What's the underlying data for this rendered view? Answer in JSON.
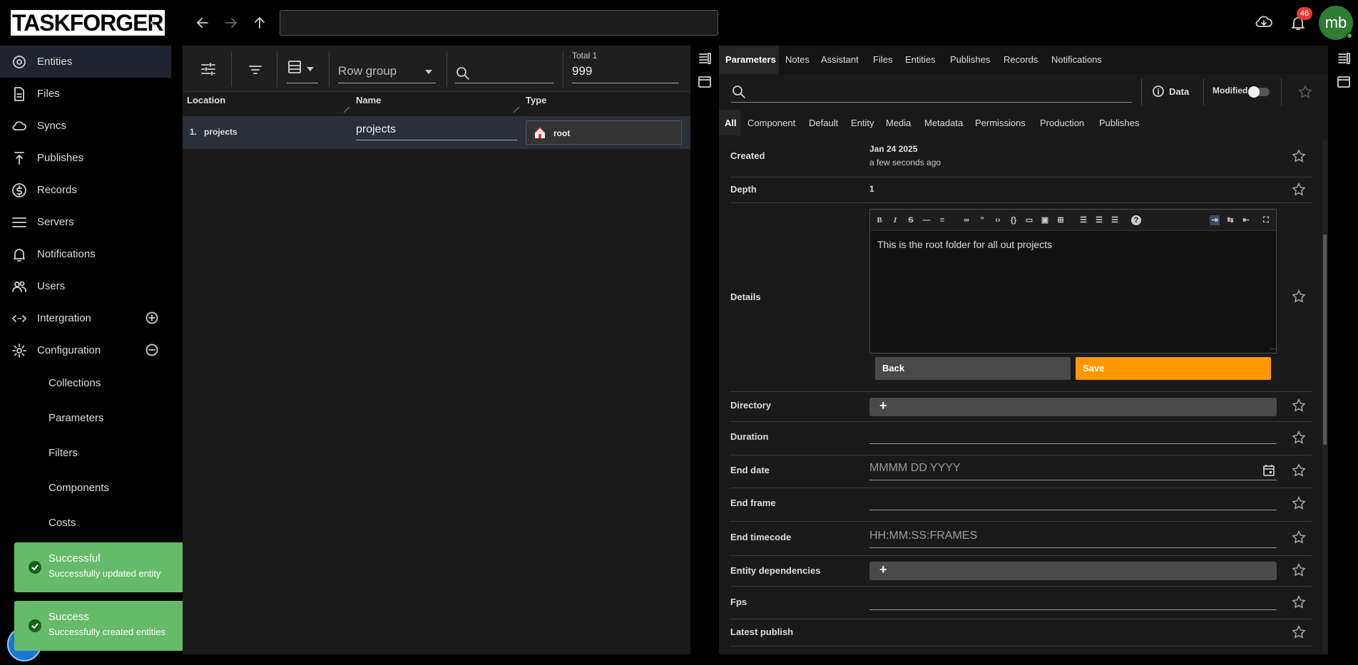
{
  "app": {
    "logo_text": "TASKFORGER",
    "user_initials": "mb",
    "notification_count": "46",
    "address_value": ""
  },
  "sidebar": {
    "items": [
      {
        "label": "Entities",
        "icon": "entities-icon"
      },
      {
        "label": "Files",
        "icon": "file-icon"
      },
      {
        "label": "Syncs",
        "icon": "cloud-sync-icon"
      },
      {
        "label": "Publishes",
        "icon": "publish-icon"
      },
      {
        "label": "Records",
        "icon": "dollar-icon"
      },
      {
        "label": "Servers",
        "icon": "server-icon"
      },
      {
        "label": "Notifications",
        "icon": "bell-icon"
      },
      {
        "label": "Users",
        "icon": "users-icon"
      },
      {
        "label": "Intergration",
        "icon": "integration-icon"
      },
      {
        "label": "Configuration",
        "icon": "gear-icon"
      }
    ],
    "config_sub": [
      "Collections",
      "Parameters",
      "Filters",
      "Components",
      "Costs"
    ]
  },
  "toasts": [
    {
      "title": "Successful",
      "message": "Successfully updated entity"
    },
    {
      "title": "Success",
      "message": "Successfully created entities"
    }
  ],
  "grid": {
    "row_group_placeholder": "Row group",
    "total_label": "Total 1",
    "total_value": "999",
    "columns": [
      "Location",
      "Name",
      "Type"
    ],
    "rows": [
      {
        "index": "1.",
        "location": "projects",
        "name": "projects",
        "type": "root"
      }
    ]
  },
  "panel": {
    "tabs": [
      "Parameters",
      "Notes",
      "Assistant",
      "Files",
      "Entities",
      "Publishes",
      "Records",
      "Notifications"
    ],
    "data_button": "Data",
    "modified_label": "Modified",
    "subtabs": [
      "All",
      "Component",
      "Default",
      "Entity",
      "Media",
      "Metadata",
      "Permissions",
      "Production",
      "Publishes"
    ],
    "created": {
      "label": "Created",
      "date": "Jan 24 2025",
      "relative": "a few seconds ago"
    },
    "depth": {
      "label": "Depth",
      "value": "1"
    },
    "details": {
      "label": "Details",
      "text": "This is the root folder for all out projects",
      "back": "Back",
      "save": "Save"
    },
    "rows": {
      "directory": "Directory",
      "duration": "Duration",
      "end_date": "End date",
      "end_date_placeholder": "MMMM DD YYYY",
      "end_frame": "End frame",
      "end_timecode": "End timecode",
      "end_timecode_placeholder": "HH:MM:SS:FRAMES",
      "entity_dependencies": "Entity dependencies",
      "fps": "Fps",
      "latest_publish": "Latest publish"
    },
    "colors": {
      "accent": "#ff9800",
      "toast": "#66bb6a",
      "badge": "#e53935",
      "avatar": "#2e7d32"
    }
  }
}
